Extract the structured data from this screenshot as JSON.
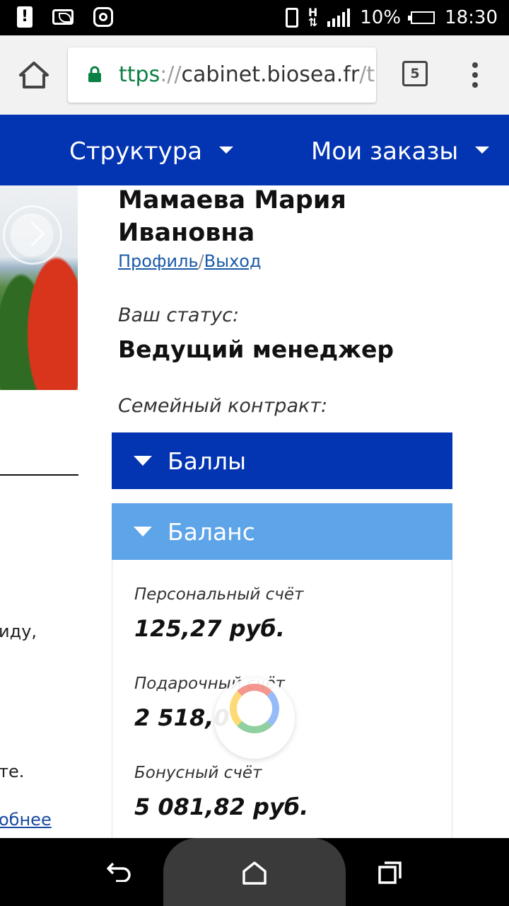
{
  "status_bar": {
    "battery": "10%",
    "time": "18:30",
    "network": "H"
  },
  "browser": {
    "url_scheme": "ttps",
    "url_separator": "://",
    "url_host": "cabinet.biosea.fr",
    "url_path": "/t",
    "tab_count": "5"
  },
  "site_nav": {
    "structure": "Структура",
    "orders": "Мои заказы"
  },
  "sidebar": {
    "fragment_1": "иду,",
    "fragment_2": "те.",
    "more_link": "обнее"
  },
  "user": {
    "name_line1": "Мамаева Мария",
    "name_line2": "Ивановна",
    "profile_link": "Профиль",
    "slash": "/",
    "logout_link": "Выход",
    "status_label": "Ваш статус:",
    "status_value": "Ведущий менеджер",
    "contract_label": "Семейный контракт:"
  },
  "accordion": {
    "points_label": "Баллы",
    "balance_label": "Баланс"
  },
  "accounts": [
    {
      "label": "Персональный счёт",
      "value": "125,27 руб."
    },
    {
      "label": "Подарочный счёт",
      "value": "2 518,0"
    },
    {
      "label": "Бонусный счёт",
      "value": "5 081,82 руб."
    }
  ],
  "colors": {
    "brand_blue": "#0334b2",
    "accordion_active": "#5da4e8",
    "link": "#1a5aa8",
    "secure_green": "#0b8043"
  }
}
